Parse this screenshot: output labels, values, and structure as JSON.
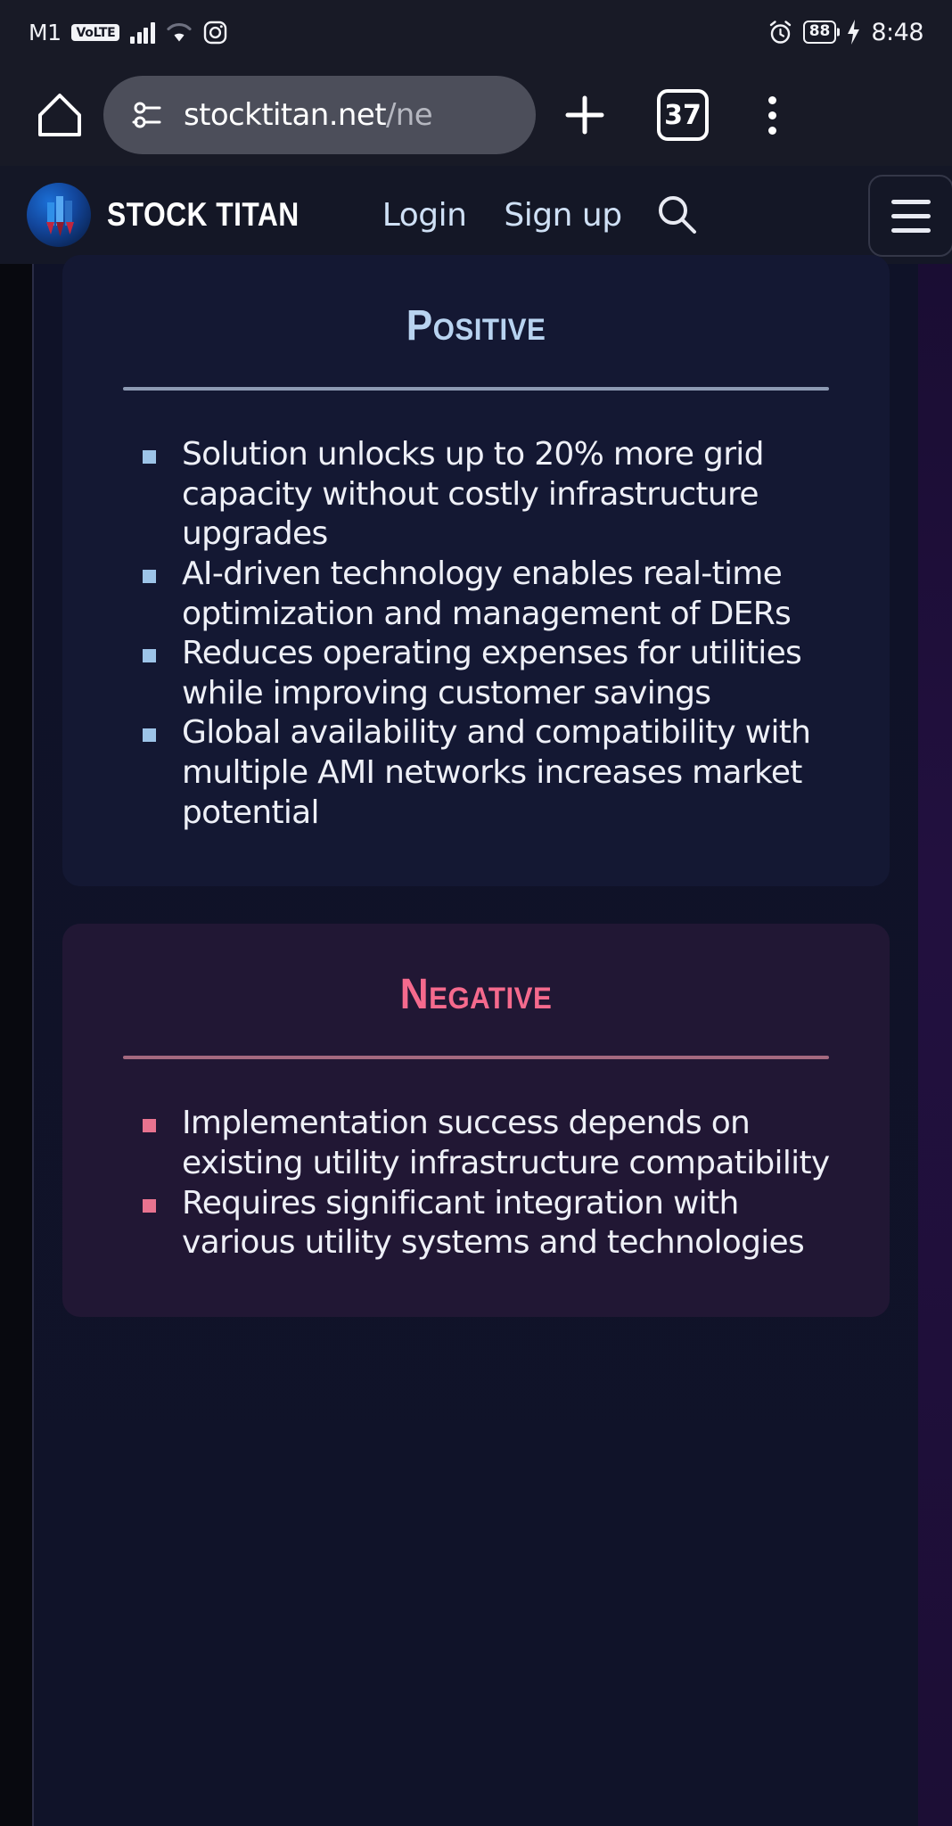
{
  "status_bar": {
    "carrier": "M1",
    "volte": "VoLTE",
    "signal_icon": "signal-bars-icon",
    "wifi_icon": "wifi-icon",
    "app_icon": "instagram-icon",
    "alarm_icon": "alarm-clock-icon",
    "battery_level": "88",
    "charging_icon": "charging-bolt-icon",
    "time": "8:48"
  },
  "browser_bar": {
    "home_icon": "home-icon",
    "site_info_icon": "site-settings-icon",
    "url_host": "stocktitan.net",
    "url_path": "/ne",
    "new_tab_icon": "plus-icon",
    "tab_count": "37",
    "overflow_icon": "more-vertical-icon"
  },
  "site_header": {
    "logo_icon": "stock-titan-logo-icon",
    "brand": "STOCK TITAN",
    "login_label": "Login",
    "signup_label": "Sign up",
    "search_icon": "search-icon",
    "menu_icon": "hamburger-menu-icon"
  },
  "analysis": {
    "positive": {
      "title": "Positive",
      "accent": "#b8d3f0",
      "bullet_color": "#9dc4e8",
      "points": [
        "Solution unlocks up to 20% more grid capacity without costly infrastructure upgrades",
        "AI-driven technology enables real-time optimization and management of DERs",
        "Reduces operating expenses for utilities while improving customer savings",
        "Global availability and compatibility with multiple AMI networks increases market potential"
      ]
    },
    "negative": {
      "title": "Negative",
      "accent": "#f56a8d",
      "bullet_color": "#e8738f",
      "points": [
        "Implementation success depends on existing utility infrastructure compatibility",
        "Requires significant integration with various utility systems and technologies"
      ]
    }
  }
}
